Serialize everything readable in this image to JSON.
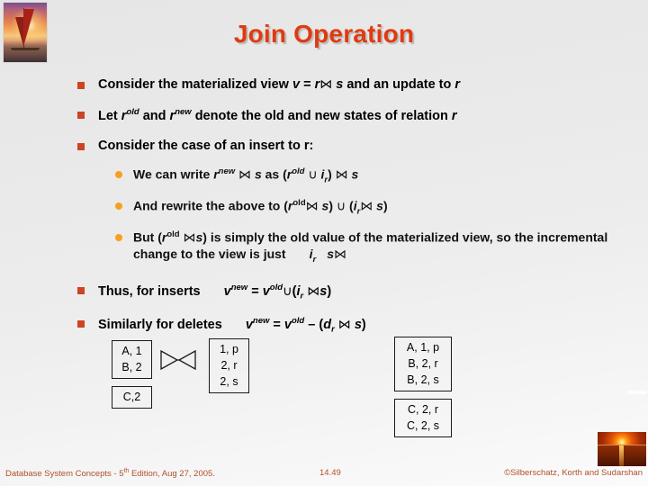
{
  "slide": {
    "title": "Join Operation",
    "decor_top_left_icon": "sailboat-sunset-photo",
    "decor_bottom_right_icon": "sunset-over-water-photo"
  },
  "bullets": {
    "b1": {
      "pre": "Consider the materialized view ",
      "v": "v",
      "eq": " = ",
      "r": "r",
      "join": "⋈",
      "s": "s",
      "post": "  and an update to ",
      "r2": "r"
    },
    "b2": {
      "pre": "Let ",
      "r": "r",
      "old": "old",
      "mid": " and ",
      "r2": "r",
      "new": "new",
      "post": " denote the old and new states of relation ",
      "r3": "r"
    },
    "b3": {
      "text": "Consider the case of an insert to r:"
    },
    "s1": {
      "pre": "We can write ",
      "r": "r",
      "new": "new",
      "join1": "⋈",
      "s1": "s",
      "as": " as (",
      "r2": "r",
      "old": "old",
      "cup": "∪",
      "i": "i",
      "isub": "r",
      "close": ") ",
      "join2": "⋈",
      "s2": "s"
    },
    "s2": {
      "pre": "And rewrite the above to  (",
      "r": "r",
      "old": "old",
      "join1": "⋈",
      "s1": "s",
      "close1": ") ",
      "cup": "∪",
      "open2": " (",
      "i": "i",
      "isub": "r",
      "join2": "⋈",
      "s2": "s",
      "close2": ")"
    },
    "s3": {
      "pre": "But (",
      "r": "r",
      "old": "old",
      "join1": "⋈",
      "s1": "s",
      "post": ") is simply the old value of the materialized view, so the incremental change to the view is just",
      "i": "i",
      "isub": "r",
      "s2": "s",
      "join2": "⋈"
    },
    "b4": {
      "label": "Thus, for inserts",
      "v": "v",
      "new": "new",
      "eq": " = ",
      "v2": "v",
      "old": "old",
      "cup": "∪",
      "open": "(",
      "i": "i",
      "isub": "r",
      "join": "⋈",
      "s": "s",
      "close": ")"
    },
    "b5": {
      "label": "Similarly for deletes",
      "v": "v",
      "new": "new",
      "eq": " = ",
      "v2": "v",
      "old": "old",
      "minus": " – ",
      "open": "(",
      "d": "d",
      "dsub": "r",
      "join": "⋈",
      "s": "s",
      "close": ")"
    }
  },
  "diagram": {
    "relation_r": [
      "A, 1",
      "B, 2"
    ],
    "relation_r_insert": [
      "C,2"
    ],
    "relation_s": [
      "1, p",
      "2, r",
      "2, s"
    ],
    "result_old": [
      "A, 1, p",
      "B, 2, r",
      "B, 2, s"
    ],
    "result_delta": [
      "C, 2, r",
      "C, 2, s"
    ],
    "join_symbol": "bowtie-join-icon"
  },
  "footer": {
    "left": "Database System Concepts - 5",
    "left_sup": "th",
    "left_rest": " Edition, Aug 27, 2005.",
    "page": "14.49",
    "right": "©Silberschatz, Korth and Sudarshan"
  },
  "colors": {
    "title": "#e03a10",
    "bullet_level1": "#cc4422",
    "bullet_level2": "#f5a11e",
    "footer_text": "#b0502a",
    "background": "#ededed"
  }
}
